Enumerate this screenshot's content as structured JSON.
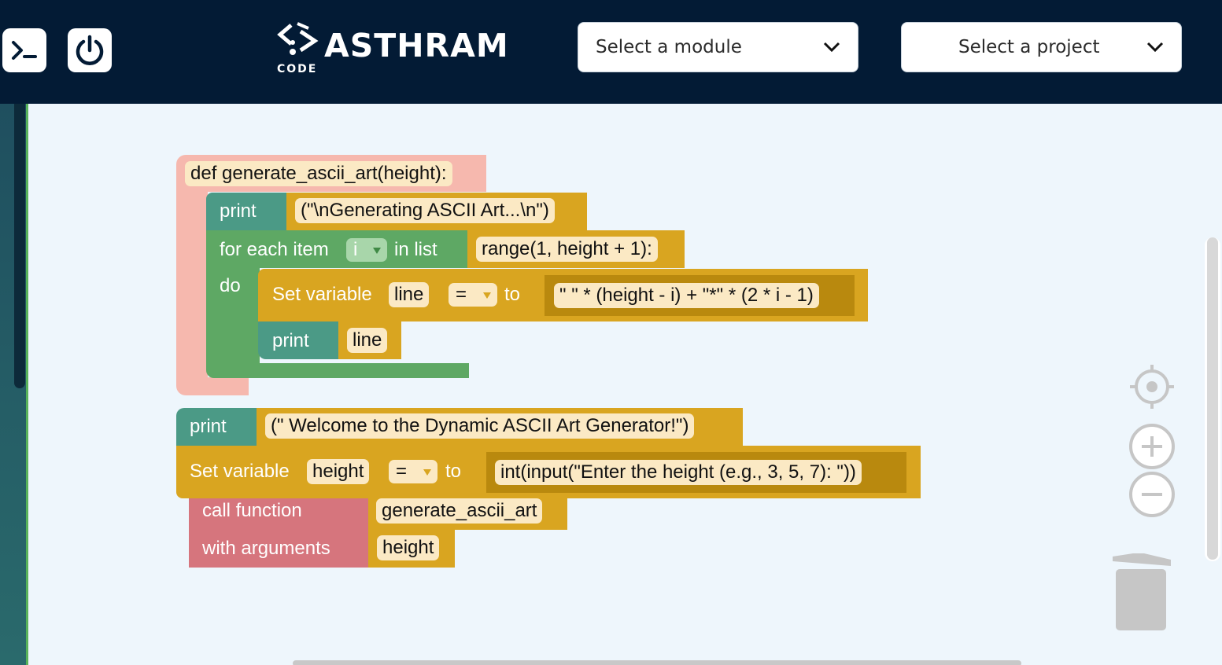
{
  "header": {
    "terminal_label": ">_",
    "logo": {
      "name": "ASTHRAM",
      "sub": "CODE"
    },
    "module_select": {
      "value": "Select a module"
    },
    "project_select": {
      "value": "Select a project"
    }
  },
  "blocks": {
    "def": {
      "label": "def generate_ascii_art(height):"
    },
    "print1": {
      "label": "print",
      "value": "(\"\\nGenerating ASCII Art...\\n\")"
    },
    "for": {
      "label": "for each item",
      "var": "i",
      "in_list": "in list",
      "value": "range(1, height + 1):",
      "do": "do"
    },
    "set_line": {
      "label": "Set variable",
      "var": "line",
      "op": "=",
      "to": "to",
      "value": "\" \" * (height - i) + \"*\" * (2 * i - 1)"
    },
    "print_line": {
      "label": "print",
      "value": "line"
    },
    "print_welcome": {
      "label": "print",
      "value": "(\" Welcome to the Dynamic ASCII Art Generator!\")"
    },
    "set_height": {
      "label": "Set variable",
      "var": "height",
      "op": "=",
      "to": "to",
      "value": "int(input(\"Enter the height (e.g., 3, 5, 7): \"))"
    },
    "call": {
      "label": "call function",
      "func": "generate_ascii_art",
      "args_label": "with arguments",
      "arg": "height"
    }
  },
  "controls": {
    "icons": [
      "recenter-icon",
      "zoom-in-icon",
      "zoom-out-icon",
      "trash-icon"
    ]
  },
  "colors": {
    "header_bg": "#031b35",
    "workspace_bg": "#eef6fc",
    "gold": "#d9a520",
    "green": "#5ea864",
    "pink": "#f6b8ae",
    "red": "#d6757d",
    "teal": "#4b9a86"
  }
}
